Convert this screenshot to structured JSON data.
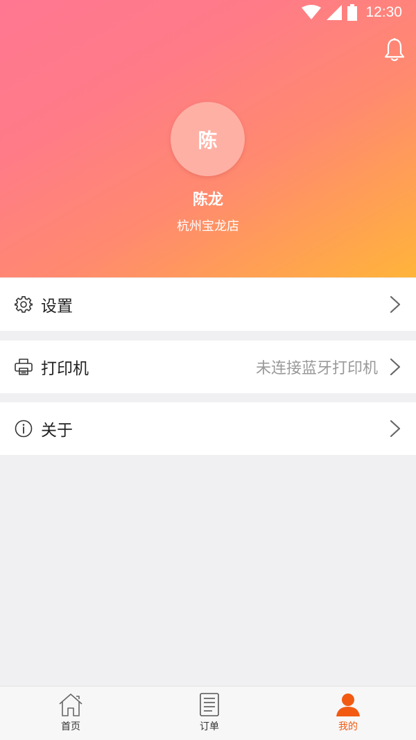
{
  "status_bar": {
    "time": "12:30"
  },
  "profile": {
    "avatar_text": "陈",
    "name": "陈龙",
    "store": "杭州宝龙店"
  },
  "menu": {
    "settings": {
      "label": "设置",
      "icon": "gear-icon"
    },
    "printer": {
      "label": "打印机",
      "value": "未连接蓝牙打印机",
      "icon": "printer-icon"
    },
    "about": {
      "label": "关于",
      "icon": "info-icon"
    }
  },
  "nav": {
    "home": {
      "label": "首页",
      "icon": "home-icon"
    },
    "orders": {
      "label": "订单",
      "icon": "order-list-icon"
    },
    "mine": {
      "label": "我的",
      "icon": "user-icon",
      "active": true
    }
  },
  "colors": {
    "gradient_start": "#ff7791",
    "gradient_end": "#ffb43a",
    "active_tab": "#f25a12",
    "background": "#f0f0f2"
  }
}
